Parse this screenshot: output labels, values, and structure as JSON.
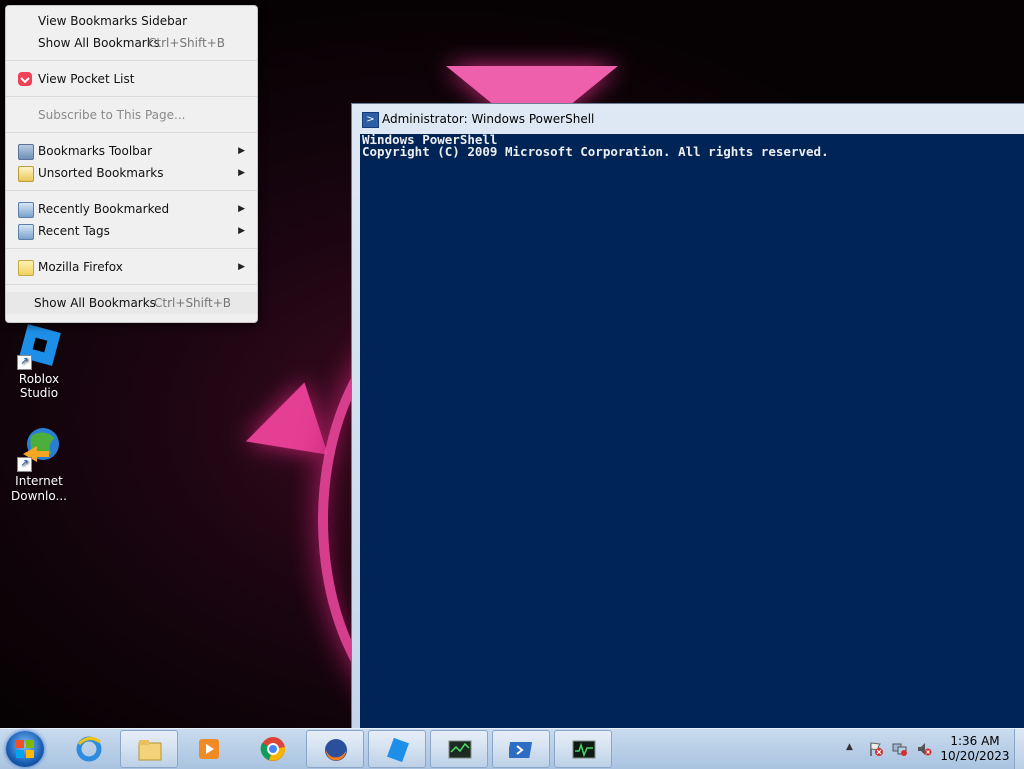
{
  "bookmarks_menu": {
    "items": [
      {
        "label": "View Bookmarks Sidebar",
        "shortcut": ""
      },
      {
        "label": "Show All Bookmarks",
        "shortcut": "Ctrl+Shift+B"
      },
      {
        "label": "View Pocket List",
        "shortcut": ""
      },
      {
        "label": "Subscribe to This Page...",
        "shortcut": ""
      },
      {
        "label": "Bookmarks Toolbar",
        "shortcut": ""
      },
      {
        "label": "Unsorted Bookmarks",
        "shortcut": ""
      },
      {
        "label": "Recently Bookmarked",
        "shortcut": ""
      },
      {
        "label": "Recent Tags",
        "shortcut": ""
      },
      {
        "label": "Mozilla Firefox",
        "shortcut": ""
      },
      {
        "label": "Show All Bookmarks",
        "shortcut": "Ctrl+Shift+B"
      }
    ],
    "submenu_arrow": "▶"
  },
  "desktop_icons": [
    {
      "label": "Roblox Studio"
    },
    {
      "label": "Internet Downlo..."
    }
  ],
  "powershell": {
    "title": "Administrator: Windows PowerShell",
    "lines": [
      "Windows PowerShell",
      "Copyright (C) 2009 Microsoft Corporation. All rights reserved."
    ]
  },
  "taskbar": {
    "pinned": [
      "internet-explorer-icon",
      "file-explorer-icon",
      "media-player-icon",
      "chrome-icon",
      "firefox-icon",
      "roblox-studio-icon",
      "task-manager-icon",
      "powershell-icon",
      "resource-monitor-icon"
    ],
    "clock_time": "1:36 AM",
    "clock_date": "10/20/2023",
    "tray_arrow": "▲"
  },
  "colors": {
    "console_bg": "#012456",
    "accent_pink": "#e9459a"
  }
}
